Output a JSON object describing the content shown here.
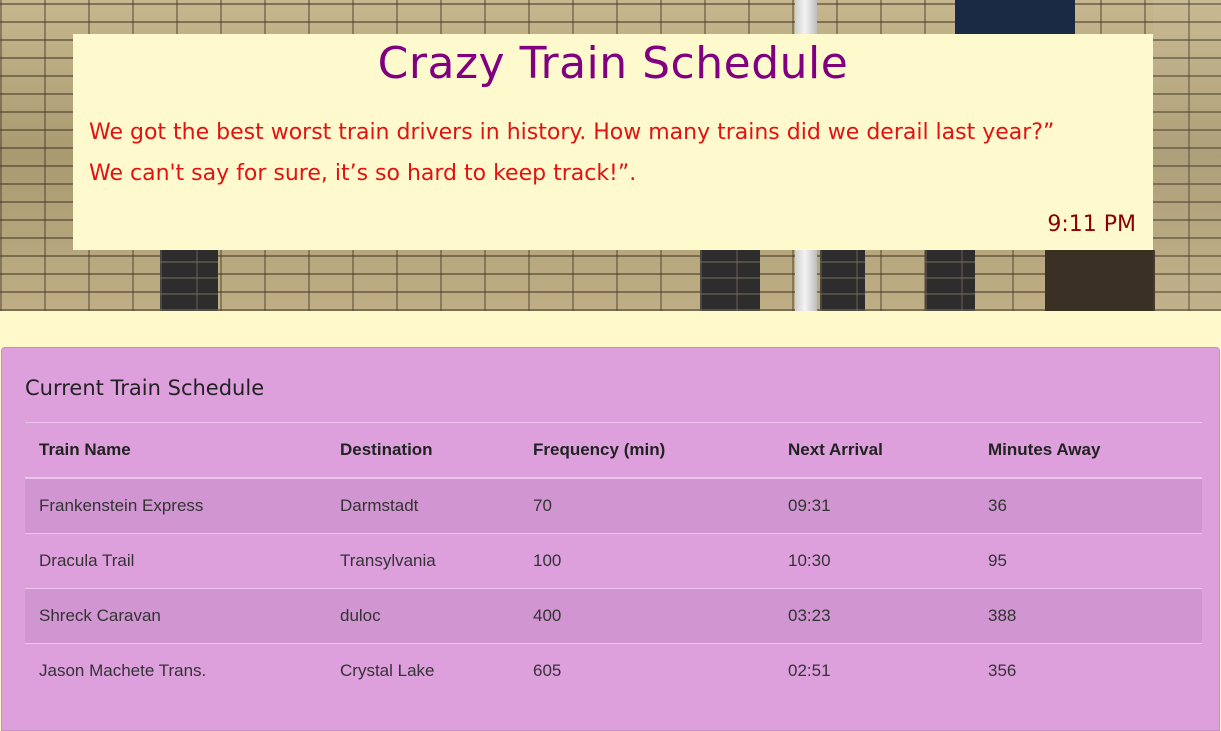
{
  "header": {
    "title": "Crazy Train Schedule",
    "quote_line1": "We got the best worst train drivers in history. How many trains did we derail last year?”",
    "quote_line2": "We can't say for sure, it’s so hard to keep track!”.",
    "clock": "9:11 PM"
  },
  "schedule": {
    "title": "Current Train Schedule",
    "columns": [
      "Train Name",
      "Destination",
      "Frequency (min)",
      "Next Arrival",
      "Minutes Away"
    ],
    "rows": [
      [
        "Frankenstein Express",
        "Darmstadt",
        "70",
        "09:31",
        "36"
      ],
      [
        "Dracula Trail",
        "Transylvania",
        "100",
        "10:30",
        "95"
      ],
      [
        "Shreck Caravan",
        "duloc",
        "400",
        "03:23",
        "388"
      ],
      [
        "Jason Machete Trans.",
        "Crystal Lake",
        "605",
        "02:51",
        "356"
      ]
    ]
  },
  "colors": {
    "page_bg": "#fff9cc",
    "title": "#800080",
    "quote": "#e31212",
    "clock": "#8b0000",
    "panel_bg": "#dda0dd"
  }
}
